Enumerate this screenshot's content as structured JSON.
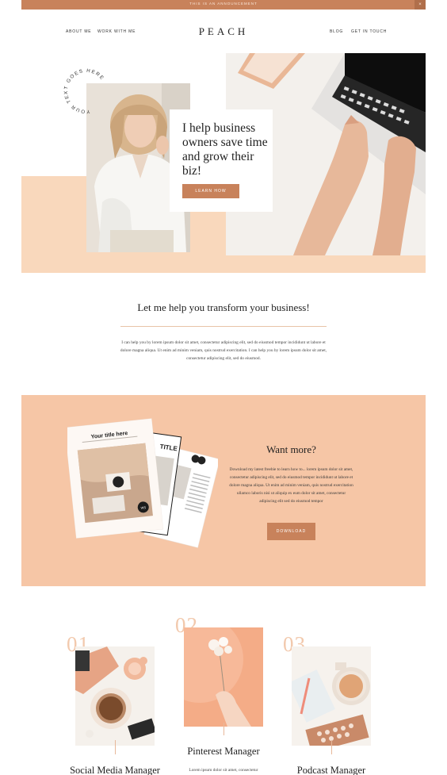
{
  "announcement": {
    "text": "THIS IS AN ANNOUNCEMENT",
    "close": "×"
  },
  "nav": {
    "left": [
      "ABOUT ME",
      "WORK WITH ME"
    ],
    "logo": "PEACH",
    "right": [
      "BLOG",
      "GET IN TOUCH"
    ]
  },
  "hero": {
    "circular_text": "YOUR TEXT GOES HERE",
    "heading": "I help business owners save time and grow their biz!",
    "button": "LEARN HOW"
  },
  "transform": {
    "title": "Let me help you transform your business!",
    "body": "I can help you by lorem ipsum dolor sit amet, consectetur adipiscing elit, sed do eiusmod tempor incididunt ut labore et dolore magna aliqua. Ut enim ad minim veniam, quis nostrud exercitation. I can help you by lorem ipsum dolor sit amet, consectetur adipiscing elit, sed do eiusmod."
  },
  "freebie": {
    "title": "Want more?",
    "body": "Download my latest freebie to learn how to... lorem ipsum dolor sit amet, consectetur adipiscing elit, sed do eiusmod tempor incididunt ut labore et dolore magna aliqua. Ut enim ad minim veniam, quis nostrud exercitation ullamco laboris nisi ut aliquip ex eum dolor sit amet, consectetur adipiscing elit sed do eiusmod tempor",
    "button": "DOWNLOAD",
    "mockup_title": "Your title here",
    "mockup_page_title": "TITLE",
    "mockup_badge": "WS"
  },
  "services": [
    {
      "number": "01.",
      "title": "Social Media Manager",
      "desc": ""
    },
    {
      "number": "02.",
      "title": "Pinterest Manager",
      "desc": "Lorem ipsum dolor sit amet, consectetur"
    },
    {
      "number": "03.",
      "title": "Podcast Manager",
      "desc": ""
    }
  ],
  "colors": {
    "accent": "#c8825b",
    "peach": "#f9d8bc",
    "peach_section": "#f6c6a6",
    "number": "#f2c9ad"
  }
}
